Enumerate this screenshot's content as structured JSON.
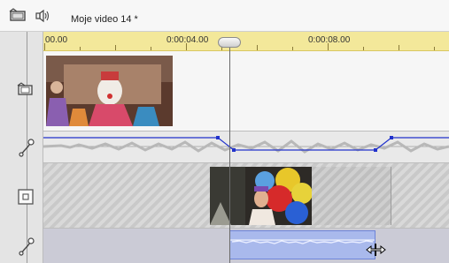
{
  "window": {
    "title": "Moje video 14 *"
  },
  "toolbar": {
    "icons": [
      "film-icon",
      "speaker-icon"
    ]
  },
  "ruler": {
    "labels": [
      "00.00",
      "0:00:04.00",
      "0:00:08.00"
    ]
  },
  "tracks": [
    {
      "name": "video-track-1",
      "icon": "film-icon"
    },
    {
      "name": "audio-track-1",
      "icon": "volume-envelope-icon"
    },
    {
      "name": "video-track-2",
      "icon": "overlay-icon"
    },
    {
      "name": "audio-track-2",
      "icon": "volume-envelope-icon"
    }
  ],
  "colors": {
    "ruler": "#f3e89a",
    "volume_line": "#2233cc",
    "audio_clip": "#a9b9ec"
  }
}
